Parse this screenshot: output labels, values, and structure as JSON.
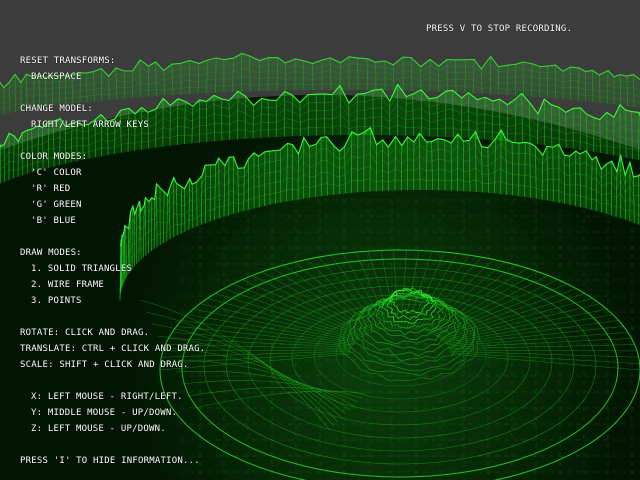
{
  "recording_notice": "PRESS V TO STOP RECORDING.",
  "info": {
    "reset_heading": "RESET TRANSFORMS:",
    "reset_key": "BACKSPACE",
    "change_model_heading": "CHANGE MODEL:",
    "change_model_keys": "RIGHT/LEFT ARROW KEYS",
    "color_modes_heading": "COLOR MODES:",
    "color_modes": [
      "'C' COLOR",
      "'R' RED",
      "'G' GREEN",
      "'B' BLUE"
    ],
    "draw_modes_heading": "DRAW MODES:",
    "draw_modes": [
      "1. SOLID TRIANGLES",
      "2. WIRE FRAME",
      "3. POINTS"
    ],
    "rotate": "ROTATE: CLICK AND DRAG.",
    "translate": "TRANSLATE: CTRL + CLICK AND DRAG.",
    "scale": "SCALE: SHIFT + CLICK AND DRAG.",
    "axes": [
      "X: LEFT MOUSE - RIGHT/LEFT.",
      "Y: MIDDLE MOUSE - UP/DOWN.",
      "Z: LEFT MOUSE - UP/DOWN."
    ],
    "hide_hint": "PRESS 'I' TO HIDE INFORMATION..."
  },
  "colors": {
    "background": "#3c3c3c",
    "wire_bright": "#33ff33",
    "wire_mid": "#1fbf1f",
    "wire_dark": "#0a4a0a",
    "hud_text": "#ffffff"
  },
  "render": {
    "model": "green wireframe terrain rings",
    "draw_mode": "wire frame",
    "color_mode": "green"
  }
}
